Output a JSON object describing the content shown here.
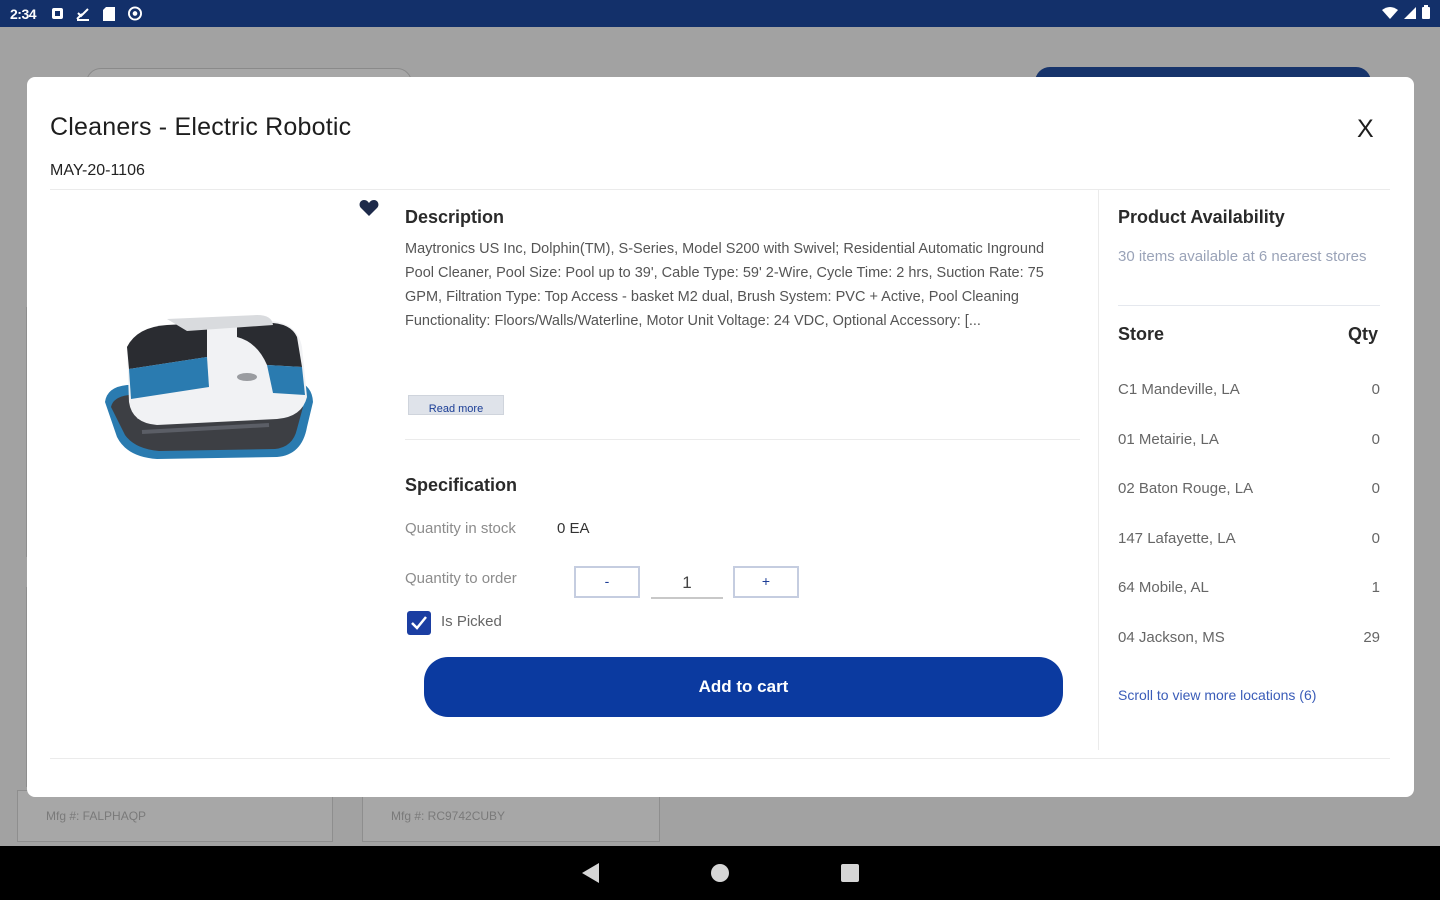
{
  "status_bar": {
    "time": "2:34"
  },
  "background": {
    "cards": [
      {
        "mfg": "Mfg #: FALPHAQP"
      },
      {
        "mfg": "Mfg #: RC9742CUBY"
      }
    ]
  },
  "modal": {
    "title": "Cleaners - Electric Robotic",
    "sku": "MAY-20-1106",
    "close_label": "X",
    "description": {
      "heading": "Description",
      "text": "Maytronics US Inc, Dolphin(TM), S-Series, Model S200 with Swivel; Residential Automatic Inground Pool Cleaner, Pool Size: Pool up to 39', Cable Type: 59' 2-Wire, Cycle Time: 2 hrs, Suction Rate: 75 GPM, Filtration Type: Top Access - basket M2 dual, Brush System: PVC + Active, Pool Cleaning Functionality: Floors/Walls/Waterline, Motor Unit Voltage: 24 VDC, Optional Accessory: [...",
      "read_more": "Read more"
    },
    "specification": {
      "heading": "Specification",
      "stock_label": "Quantity in stock",
      "stock_value": "0 EA",
      "order_label": "Quantity to order",
      "minus_label": "-",
      "plus_label": "+",
      "order_value": "1",
      "picked_label": "Is Picked"
    },
    "add_to_cart": "Add to cart",
    "availability": {
      "heading": "Product Availability",
      "summary": "30 items available at 6 nearest stores",
      "store_header": "Store",
      "qty_header": "Qty",
      "stores": [
        {
          "name": "C1 Mandeville, LA",
          "qty": "0"
        },
        {
          "name": "01 Metairie, LA",
          "qty": "0"
        },
        {
          "name": "02 Baton Rouge, LA",
          "qty": "0"
        },
        {
          "name": "147 Lafayette, LA",
          "qty": "0"
        },
        {
          "name": "64 Mobile, AL",
          "qty": "1"
        },
        {
          "name": "04 Jackson, MS",
          "qty": "29"
        }
      ],
      "scroll_more": "Scroll to view more locations (6)"
    }
  },
  "colors": {
    "status_bar": "#13306a",
    "primary": "#0b3aa0",
    "checkbox": "#1b3ea2",
    "link": "#3a5cb8"
  }
}
